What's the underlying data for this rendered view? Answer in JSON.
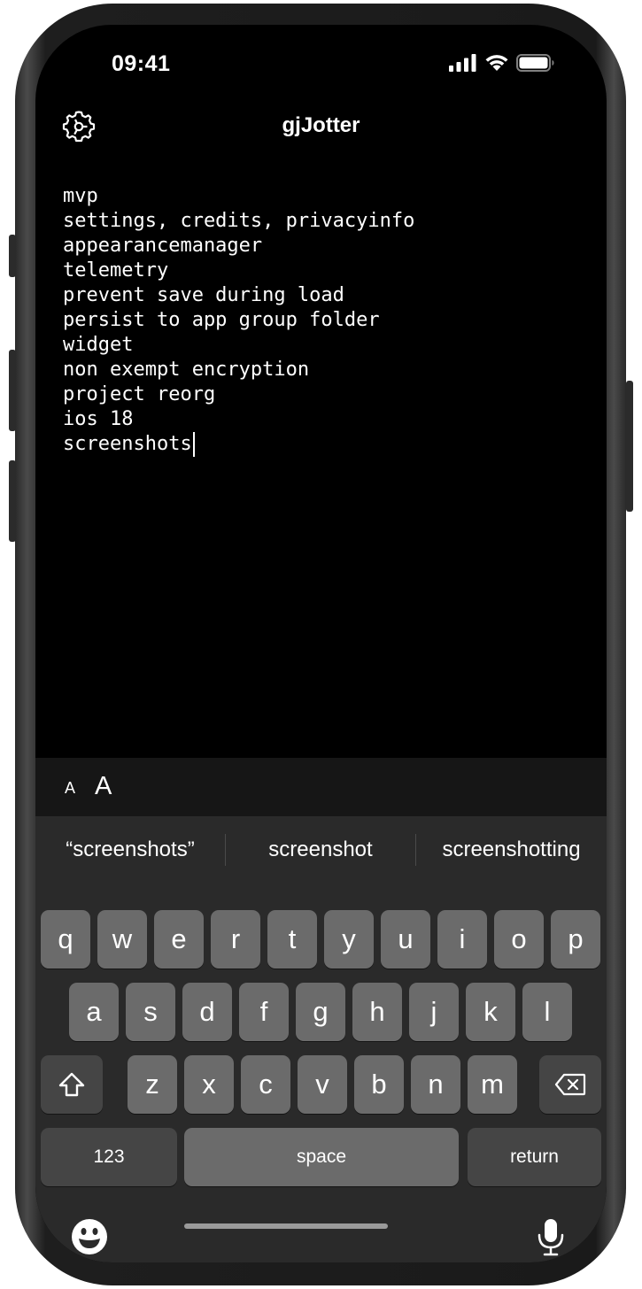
{
  "status_bar": {
    "time": "09:41",
    "signal_icon": "cellular-signal-icon",
    "wifi_icon": "wifi-icon",
    "battery_icon": "battery-icon"
  },
  "nav": {
    "title": "gjJotter",
    "settings_icon": "gear-icon"
  },
  "note": {
    "lines": [
      "mvp",
      "settings, credits, privacyinfo",
      "appearancemanager",
      "telemetry",
      "prevent save during load",
      "persist to app group folder",
      "widget",
      "non exempt encryption",
      "project reorg",
      "ios 18",
      "screenshots"
    ]
  },
  "accessory": {
    "decrease_font_label": "A",
    "increase_font_label": "A"
  },
  "keyboard": {
    "suggestions": [
      "“screenshots”",
      "screenshot",
      "screenshotting"
    ],
    "row1": [
      "q",
      "w",
      "e",
      "r",
      "t",
      "y",
      "u",
      "i",
      "o",
      "p"
    ],
    "row2": [
      "a",
      "s",
      "d",
      "f",
      "g",
      "h",
      "j",
      "k",
      "l"
    ],
    "row3": [
      "z",
      "x",
      "c",
      "v",
      "b",
      "n",
      "m"
    ],
    "numbers_label": "123",
    "space_label": "space",
    "return_label": "return",
    "shift_icon": "shift-icon",
    "delete_icon": "delete-icon",
    "emoji_icon": "emoji-icon",
    "mic_icon": "microphone-icon"
  }
}
